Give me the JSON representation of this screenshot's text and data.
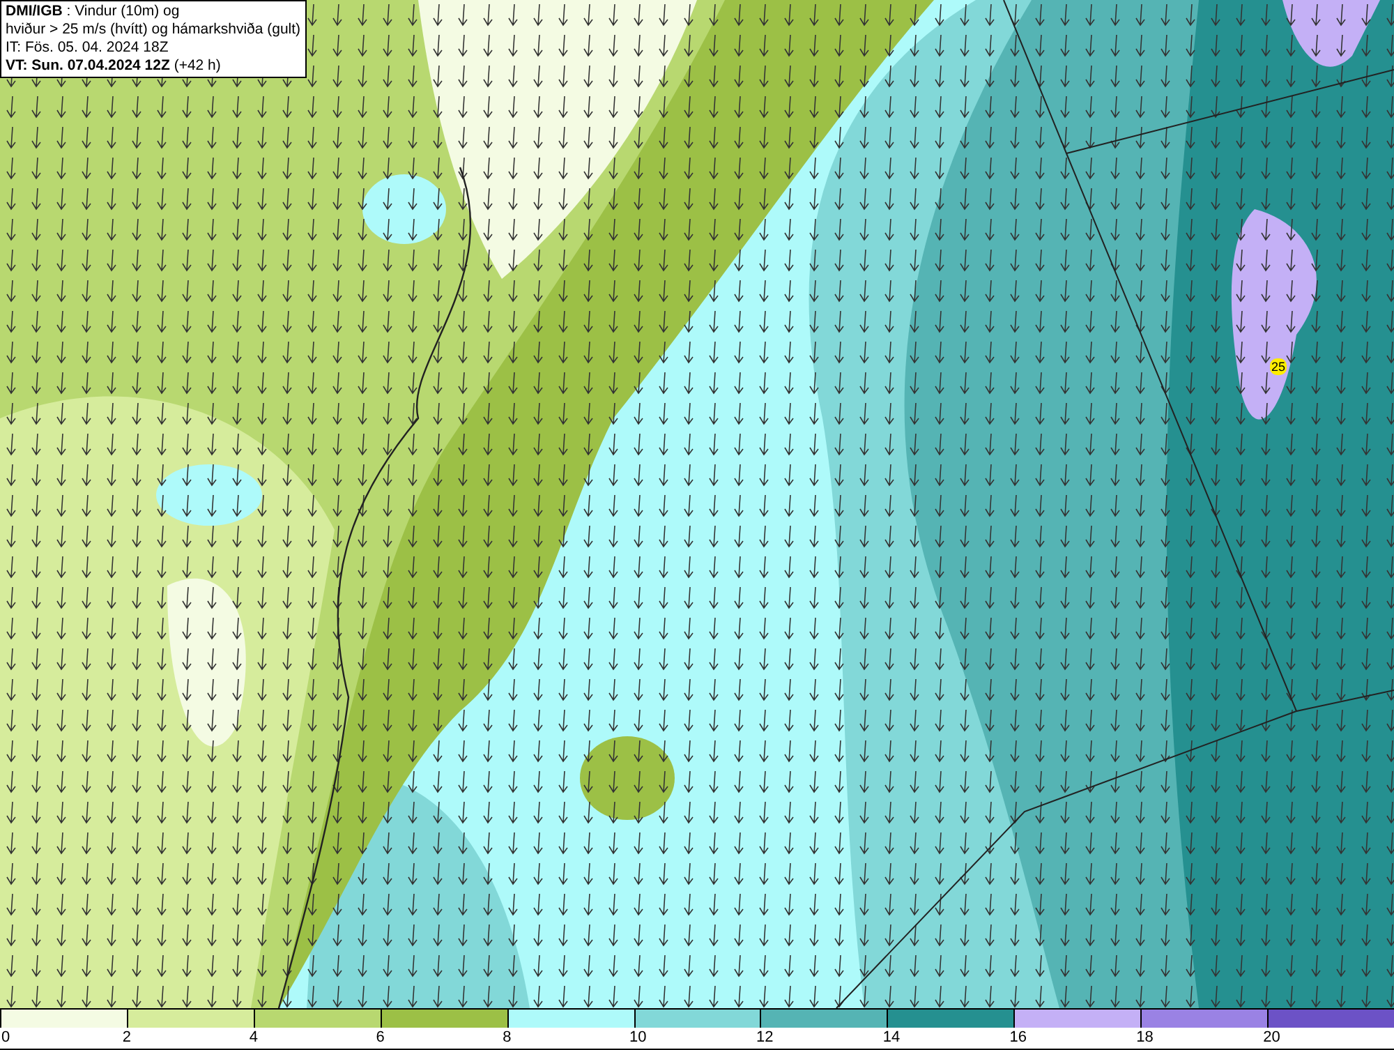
{
  "header": {
    "lines": [
      "**DMI/IGB** : Vindur (10m) og",
      "hviður > 25 m/s (hvítt) og hámarkshviða (gult)",
      "IT: Fös. 05. 04. 2024 18Z",
      "**VT: Sun. 07.04.2024 12Z** (+42 h)"
    ]
  },
  "map": {
    "gust_marks": [
      {
        "label": "25"
      }
    ]
  },
  "legend": [
    {
      "label": "0",
      "color": "#f4fbe3"
    },
    {
      "label": "2",
      "color": "#d6ec9c"
    },
    {
      "label": "4",
      "color": "#b8d870"
    },
    {
      "label": "6",
      "color": "#9cc046"
    },
    {
      "label": "8",
      "color": "#aefafa"
    },
    {
      "label": "10",
      "color": "#82d8d8"
    },
    {
      "label": "12",
      "color": "#55b4b4"
    },
    {
      "label": "14",
      "color": "#259090"
    },
    {
      "label": "16",
      "color": "#c4b0f6"
    },
    {
      "label": "18",
      "color": "#9a82e4"
    },
    {
      "label": "20",
      "color": "#6c52c6"
    }
  ]
}
